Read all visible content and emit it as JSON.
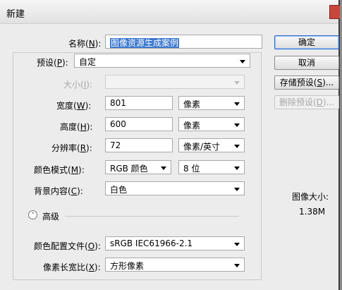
{
  "window": {
    "title": "新建"
  },
  "form": {
    "name": {
      "label": "名称(",
      "key": "N",
      "label_end": "):",
      "value": "图像资源生成案例"
    },
    "preset": {
      "label": "预设(",
      "key": "P",
      "label_end": "):",
      "value": "自定"
    },
    "size": {
      "label": "大小(",
      "key": "I",
      "label_end": "):",
      "value": ""
    },
    "width": {
      "label": "宽度(",
      "key": "W",
      "label_end": "):",
      "value": "801",
      "unit": "像素"
    },
    "height": {
      "label": "高度(",
      "key": "H",
      "label_end": "):",
      "value": "600",
      "unit": "像素"
    },
    "resolution": {
      "label": "分辨率(",
      "key": "R",
      "label_end": "):",
      "value": "72",
      "unit": "像素/英寸"
    },
    "color_mode": {
      "label": "颜色模式(",
      "key": "M",
      "label_end": "):",
      "value": "RGB 颜色",
      "depth": "8 位"
    },
    "background": {
      "label": "背景内容(",
      "key": "C",
      "label_end": "):",
      "value": "白色"
    },
    "advanced": {
      "label": "高级"
    },
    "color_profile": {
      "label": "颜色配置文件(",
      "key": "O",
      "label_end": "):",
      "value": "sRGB IEC61966-2.1"
    },
    "pixel_aspect": {
      "label": "像素长宽比(",
      "key": "X",
      "label_end": "):",
      "value": "方形像素"
    }
  },
  "buttons": {
    "ok": "确定",
    "cancel": "取消",
    "save_preset": {
      "label": "存储预设(",
      "key": "S",
      "label_end": ")..."
    },
    "delete_preset": {
      "label": "删除预设(",
      "key": "D",
      "label_end": ")..."
    }
  },
  "image_size": {
    "label": "图像大小:",
    "value": "1.38M"
  }
}
